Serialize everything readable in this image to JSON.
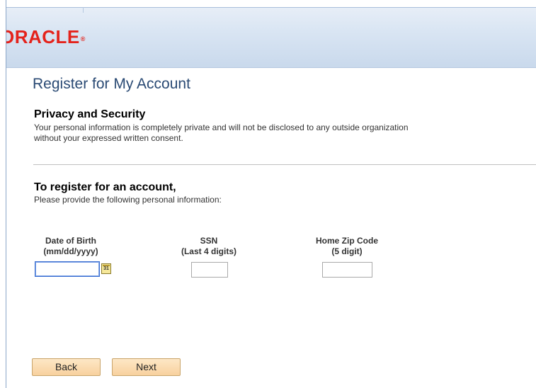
{
  "brand": {
    "logo_text": "ORACLE",
    "logo_mark": "®"
  },
  "page": {
    "title": "Register for My Account"
  },
  "privacy": {
    "heading": "Privacy and Security",
    "line1": "Your personal information is completely private and will not be disclosed to any outside organization",
    "line2": "without your expressed written consent."
  },
  "register": {
    "heading": "To register for an account,",
    "instruction": "Please provide the following personal information:"
  },
  "fields": {
    "dob": {
      "label_line1": "Date of Birth",
      "label_line2": "(mm/dd/yyyy)",
      "value": "",
      "icon": "calendar-icon",
      "icon_text": "31"
    },
    "ssn": {
      "label_line1": "SSN",
      "label_line2": "(Last 4 digits)",
      "value": ""
    },
    "zip": {
      "label_line1": "Home Zip Code",
      "label_line2": "(5 digit)",
      "value": ""
    }
  },
  "buttons": {
    "back_label": "Back",
    "next_label": "Next"
  },
  "colors": {
    "title": "#2a4a74",
    "logo": "#e4231c",
    "button_bg": "#f8d19e",
    "header_bg": "#d9e5f3"
  }
}
